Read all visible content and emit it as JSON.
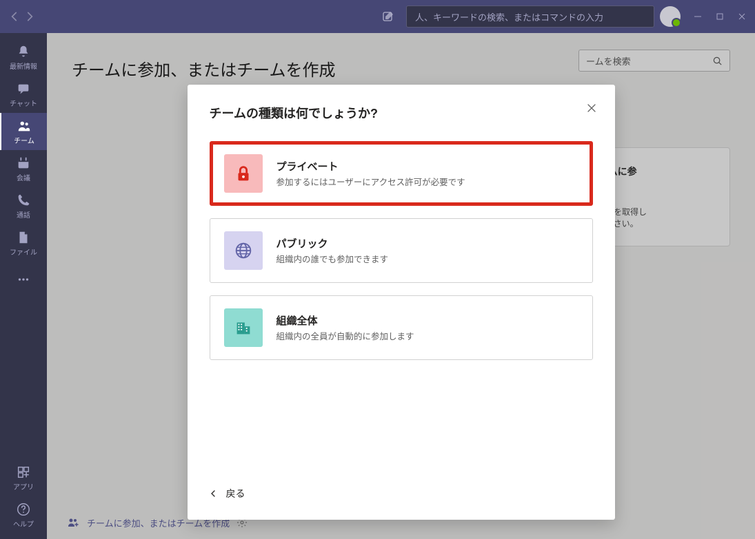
{
  "titlebar": {
    "search_placeholder": "人、キーワードの検索、またはコマンドの入力"
  },
  "sidebar": {
    "items": [
      {
        "label": "最新情報",
        "icon": "bell"
      },
      {
        "label": "チャット",
        "icon": "chat"
      },
      {
        "label": "チーム",
        "icon": "team",
        "active": true
      },
      {
        "label": "会議",
        "icon": "calendar"
      },
      {
        "label": "通話",
        "icon": "phone"
      },
      {
        "label": "ファイル",
        "icon": "file"
      },
      {
        "label": "",
        "icon": "more"
      }
    ],
    "bottom": [
      {
        "label": "アプリ",
        "icon": "apps"
      },
      {
        "label": "ヘルプ",
        "icon": "help"
      }
    ]
  },
  "page": {
    "title_fragment": "チームに参加、またはチームを作成",
    "search_teams_placeholder": "ームを検索",
    "join_card_title_fragment": "チームに参",
    "join_card_text_a": "コードを取得し",
    "join_card_text_b": "てください。",
    "bottom_link": "チームに参加、またはチームを作成"
  },
  "dialog": {
    "title": "チームの種類は何でしょうか?",
    "options": [
      {
        "title": "プライベート",
        "desc": "参加するにはユーザーにアクセス許可が必要です",
        "style": "private",
        "highlight": true
      },
      {
        "title": "パブリック",
        "desc": "組織内の誰でも参加できます",
        "style": "public"
      },
      {
        "title": "組織全体",
        "desc": "組織内の全員が自動的に参加します",
        "style": "org"
      }
    ],
    "back": "戻る"
  }
}
